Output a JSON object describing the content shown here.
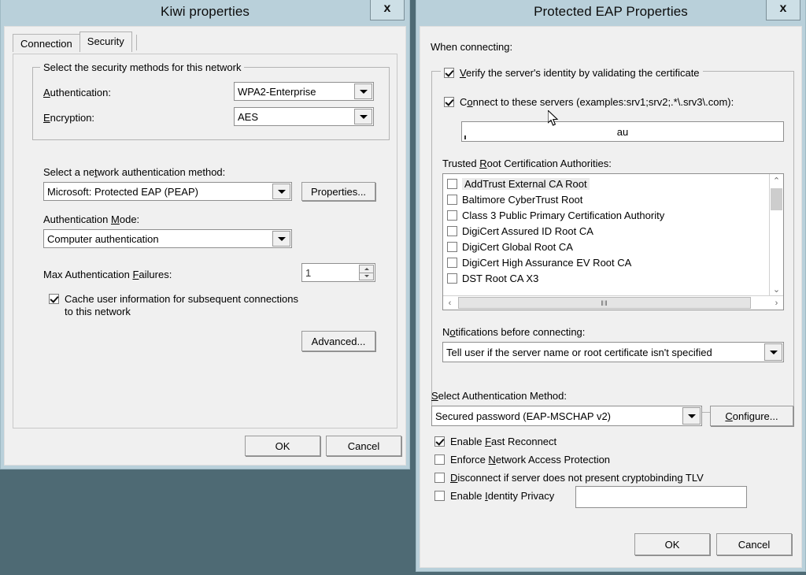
{
  "desktop": {
    "background_color": "#4e6a74"
  },
  "kiwi": {
    "title": "Kiwi properties",
    "close_label": "x",
    "tabs": [
      {
        "label": "Connection",
        "active": false
      },
      {
        "label": "Security",
        "active": true
      }
    ],
    "security_group": {
      "title": "Select the security methods for this network",
      "authentication_label": "Authentication:",
      "authentication_value": "WPA2-Enterprise",
      "encryption_label": "Encryption:",
      "encryption_value": "AES"
    },
    "network_auth_label": "Select a network authentication method:",
    "network_auth_value": "Microsoft: Protected EAP (PEAP)",
    "properties_button": "Properties...",
    "auth_mode_label": "Authentication Mode:",
    "auth_mode_value": "Computer authentication",
    "max_failures_label": "Max Authentication Failures:",
    "max_failures_value": "1",
    "cache_checkbox": {
      "line1": "Cache user information for subsequent connections",
      "line2": "to this network",
      "checked": true
    },
    "advanced_button": "Advanced...",
    "ok_button": "OK",
    "cancel_button": "Cancel"
  },
  "peap": {
    "title": "Protected EAP Properties",
    "close_label": "x",
    "when_connecting_label": "When connecting:",
    "verify_server": {
      "label": "Verify the server's identity by validating the certificate",
      "checked": true
    },
    "connect_servers": {
      "label": "Connect to these servers (examples:srv1;srv2;.*\\.srv3\\.com):",
      "checked": true
    },
    "servers_input_value": "au",
    "trusted_roots_label": "Trusted Root Certification Authorities:",
    "trusted_roots": [
      {
        "label": "AddTrust External CA Root",
        "checked": false,
        "selected": true
      },
      {
        "label": "Baltimore CyberTrust Root",
        "checked": false,
        "selected": false
      },
      {
        "label": "Class 3 Public Primary Certification Authority",
        "checked": false,
        "selected": false
      },
      {
        "label": "DigiCert Assured ID Root CA",
        "checked": false,
        "selected": false
      },
      {
        "label": "DigiCert Global Root CA",
        "checked": false,
        "selected": false
      },
      {
        "label": "DigiCert High Assurance EV Root CA",
        "checked": false,
        "selected": false
      },
      {
        "label": "DST Root CA X3",
        "checked": false,
        "selected": false
      }
    ],
    "notifications_label": "Notifications before connecting:",
    "notifications_value": "Tell user if the server name or root certificate isn't specified",
    "select_auth_method_label": "Select Authentication Method:",
    "auth_method_value": "Secured password (EAP-MSCHAP v2)",
    "configure_button": "Configure...",
    "options": [
      {
        "label": "Enable Fast Reconnect",
        "checked": true
      },
      {
        "label": "Enforce Network Access Protection",
        "checked": false
      },
      {
        "label": "Disconnect if server does not present cryptobinding TLV",
        "checked": false
      },
      {
        "label": "Enable Identity Privacy",
        "checked": false
      }
    ],
    "identity_privacy_input_value": "",
    "ok_button": "OK",
    "cancel_button": "Cancel"
  },
  "icons": {
    "scroll_up": "⌃",
    "scroll_down": "⌄",
    "scroll_left": "‹",
    "scroll_right": "›",
    "grip": "‖‖"
  }
}
